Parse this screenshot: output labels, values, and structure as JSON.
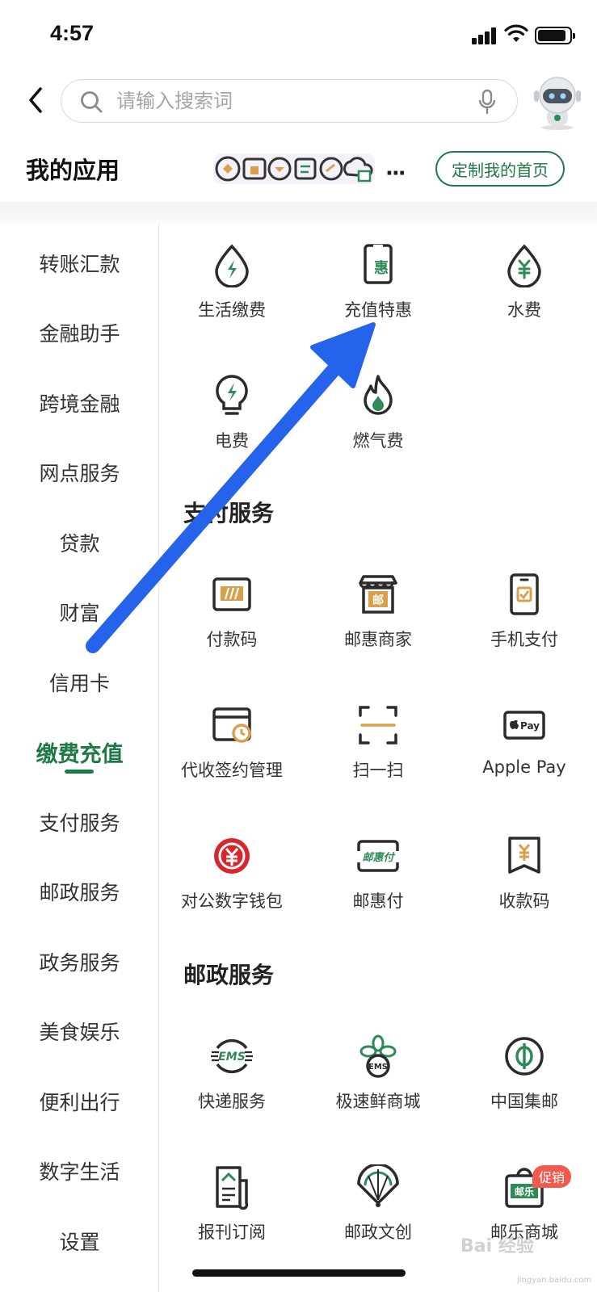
{
  "status_bar": {
    "time": "4:57"
  },
  "search": {
    "placeholder": "请输入搜索词"
  },
  "my_apps": {
    "title": "我的应用",
    "more": "···",
    "customize_label": "定制我的首页"
  },
  "sidebar": {
    "items": [
      {
        "label": "转账汇款",
        "active": false
      },
      {
        "label": "金融助手",
        "active": false
      },
      {
        "label": "跨境金融",
        "active": false
      },
      {
        "label": "网点服务",
        "active": false
      },
      {
        "label": "贷款",
        "active": false
      },
      {
        "label": "财富",
        "active": false
      },
      {
        "label": "信用卡",
        "active": false
      },
      {
        "label": "缴费充值",
        "active": true
      },
      {
        "label": "支付服务",
        "active": false
      },
      {
        "label": "邮政服务",
        "active": false
      },
      {
        "label": "政务服务",
        "active": false
      },
      {
        "label": "美食娱乐",
        "active": false
      },
      {
        "label": "便利出行",
        "active": false
      },
      {
        "label": "数字生活",
        "active": false
      },
      {
        "label": "设置",
        "active": false
      }
    ]
  },
  "sections": {
    "payment_top": {
      "items": [
        {
          "label": "生活缴费",
          "icon": "lightning-drop-icon"
        },
        {
          "label": "充值特惠",
          "icon": "phone-discount-icon",
          "icon_text": "惠"
        },
        {
          "label": "水费",
          "icon": "water-yuan-icon"
        },
        {
          "label": "电费",
          "icon": "bulb-icon"
        },
        {
          "label": "燃气费",
          "icon": "flame-icon"
        }
      ]
    },
    "pay_services": {
      "title": "支付服务",
      "items": [
        {
          "label": "付款码",
          "icon": "payment-code-icon"
        },
        {
          "label": "邮惠商家",
          "icon": "store-icon",
          "icon_text": "邮"
        },
        {
          "label": "手机支付",
          "icon": "mobile-pay-icon"
        },
        {
          "label": "代收签约管理",
          "icon": "contract-manage-icon"
        },
        {
          "label": "扫一扫",
          "icon": "scan-icon"
        },
        {
          "label": "Apple Pay",
          "icon": "apple-pay-icon",
          "icon_text": "Pay"
        },
        {
          "label": "对公数字钱包",
          "icon": "digital-yuan-icon"
        },
        {
          "label": "邮惠付",
          "icon": "youhuifu-icon",
          "icon_text": "邮惠付"
        },
        {
          "label": "收款码",
          "icon": "receive-code-icon"
        }
      ]
    },
    "postal_services": {
      "title": "邮政服务",
      "items": [
        {
          "label": "快递服务",
          "icon": "ems-icon",
          "icon_text": "EMS"
        },
        {
          "label": "极速鲜商城",
          "icon": "fresh-mall-icon",
          "icon_text": "EMS"
        },
        {
          "label": "中国集邮",
          "icon": "stamp-collect-icon"
        },
        {
          "label": "报刊订阅",
          "icon": "newspaper-icon"
        },
        {
          "label": "邮政文创",
          "icon": "fan-icon"
        },
        {
          "label": "邮乐商城",
          "icon": "youle-bag-icon",
          "icon_text": "邮乐",
          "badge": "促销"
        }
      ]
    }
  },
  "watermark": {
    "text": "Bai 经验",
    "sub": "jingyan.baidu.com"
  },
  "colors": {
    "brand_green": "#1e7a45",
    "accent_orange": "#d9a04a",
    "arrow_blue": "#2563eb",
    "badge_red": "#f3584d"
  }
}
